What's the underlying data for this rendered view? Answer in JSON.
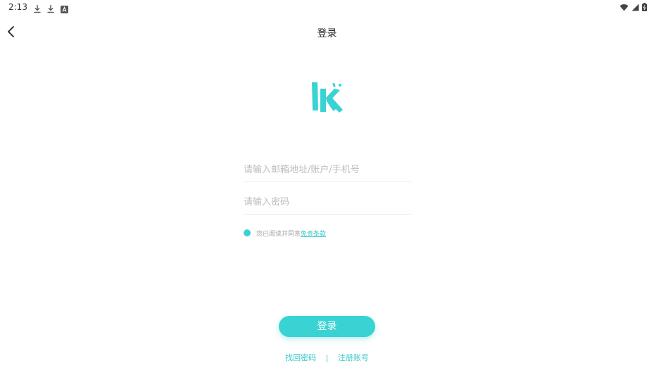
{
  "status_bar": {
    "time": "2:13",
    "left_icons": [
      "download-icon",
      "download-icon",
      "a-box-icon"
    ],
    "right_icons": [
      "wifi-icon",
      "cell-signal-icon",
      "battery-icon"
    ]
  },
  "header": {
    "title": "登录",
    "back_icon": "back-arrow-icon"
  },
  "logo": {
    "icon": "lk-logo",
    "color": "#39d3d3"
  },
  "form": {
    "account_placeholder": "请输入邮箱地址/账户/手机号",
    "account_value": "",
    "password_placeholder": "请输入密码",
    "password_value": ""
  },
  "agreement": {
    "text": "您已阅读并同意",
    "link": "免责条款",
    "checked": true
  },
  "login_button": {
    "label": "登录"
  },
  "bottom_links": {
    "forgot_password": "找回密码",
    "divider": "|",
    "register": "注册账号"
  },
  "colors": {
    "accent": "#39d3d3",
    "text_primary": "#222222",
    "placeholder": "#bdbdbd"
  }
}
